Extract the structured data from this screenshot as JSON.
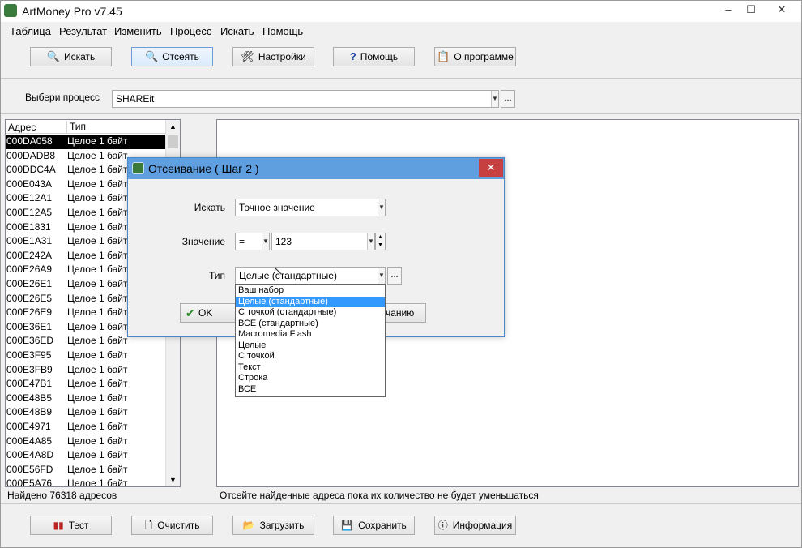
{
  "window": {
    "title": "ArtMoney Pro v7.45",
    "minimize": "–",
    "maximize": "☐",
    "close": "✕"
  },
  "menu": [
    "Таблица",
    "Результат",
    "Изменить",
    "Процесс",
    "Искать",
    "Помощь"
  ],
  "toolbar": {
    "search": "Искать",
    "filter": "Отсеять",
    "settings": "Настройки",
    "help": "Помощь",
    "about": "О программе"
  },
  "process": {
    "label": "Выбери процесс",
    "value": "SHAREit",
    "browse": "..."
  },
  "table": {
    "col_address": "Адрес",
    "col_type": "Тип",
    "rows": [
      {
        "address": "000DA058",
        "type": "Целое 1 байт"
      },
      {
        "address": "000DADB8",
        "type": "Целое 1 байт"
      },
      {
        "address": "000DDC4A",
        "type": "Целое 1 байт"
      },
      {
        "address": "000E043A",
        "type": "Целое 1 байт"
      },
      {
        "address": "000E12A1",
        "type": "Целое 1 байт"
      },
      {
        "address": "000E12A5",
        "type": "Целое 1 байт"
      },
      {
        "address": "000E1831",
        "type": "Целое 1 байт"
      },
      {
        "address": "000E1A31",
        "type": "Целое 1 байт"
      },
      {
        "address": "000E242A",
        "type": "Целое 1 байт"
      },
      {
        "address": "000E26A9",
        "type": "Целое 1 байт"
      },
      {
        "address": "000E26E1",
        "type": "Целое 1 байт"
      },
      {
        "address": "000E26E5",
        "type": "Целое 1 байт"
      },
      {
        "address": "000E26E9",
        "type": "Целое 1 байт"
      },
      {
        "address": "000E36E1",
        "type": "Целое 1 байт"
      },
      {
        "address": "000E36ED",
        "type": "Целое 1 байт"
      },
      {
        "address": "000E3F95",
        "type": "Целое 1 байт"
      },
      {
        "address": "000E3FB9",
        "type": "Целое 1 байт"
      },
      {
        "address": "000E47B1",
        "type": "Целое 1 байт"
      },
      {
        "address": "000E48B5",
        "type": "Целое 1 байт"
      },
      {
        "address": "000E48B9",
        "type": "Целое 1 байт"
      },
      {
        "address": "000E4971",
        "type": "Целое 1 байт"
      },
      {
        "address": "000E4A85",
        "type": "Целое 1 байт"
      },
      {
        "address": "000E4A8D",
        "type": "Целое 1 байт"
      },
      {
        "address": "000E56FD",
        "type": "Целое 1 байт"
      },
      {
        "address": "000E5A76",
        "type": "Целое 1 байт"
      }
    ]
  },
  "status": {
    "found": "Найдено 76318 адресов",
    "hint": "Отсейте найденные адреса пока их количество не будет уменьшаться"
  },
  "bottom": {
    "test": "Тест",
    "clear": "Очистить",
    "load": "Загрузить",
    "save": "Сохранить",
    "info": "Информация"
  },
  "dialog": {
    "title": "Отсеивание ( Шаг 2 )",
    "search_label": "Искать",
    "search_value": "Точное значение",
    "value_label": "Значение",
    "operator": "=",
    "value": "123",
    "type_label": "Тип",
    "type_value": "Целые (стандартные)",
    "ok": "OK",
    "hidden_button_fragment": "чанию",
    "type_options": [
      "Ваш набор",
      "Целые (стандартные)",
      "С точкой (стандартные)",
      "ВСЕ (стандартные)",
      "Macromedia Flash",
      "Целые",
      "С точкой",
      "Текст",
      "Строка",
      "ВСЕ"
    ],
    "selected_option_index": 1
  }
}
